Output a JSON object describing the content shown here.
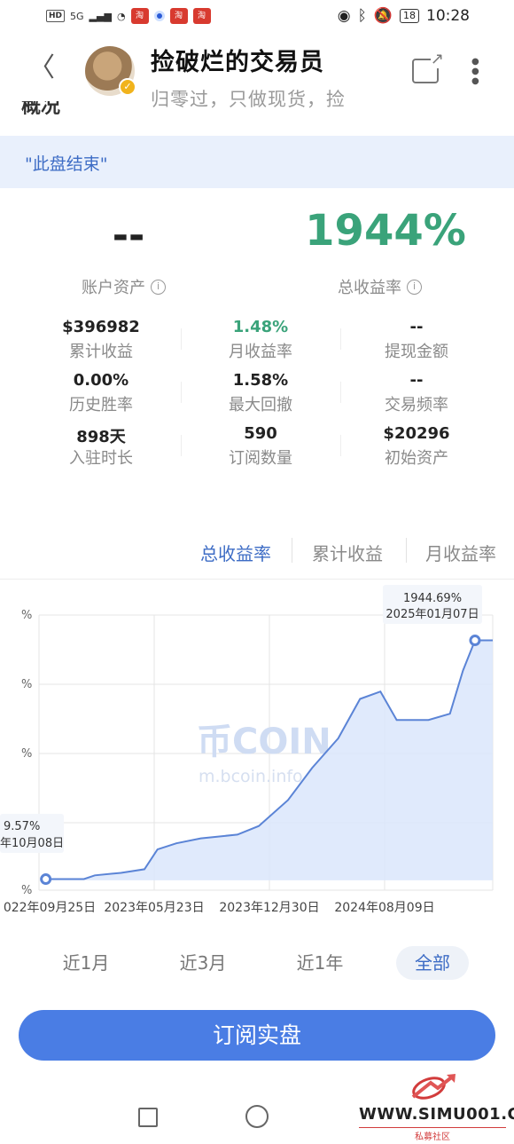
{
  "status_bar": {
    "left_badges": [
      "HD",
      "5G"
    ],
    "time": "10:28",
    "battery": "18"
  },
  "header": {
    "title": "捡破烂的交易员",
    "subtitle": "归零过，只做现货，捡",
    "section_title": "概况"
  },
  "banner": {
    "text": "\"此盘结束\""
  },
  "summary": {
    "asset_value": "--",
    "asset_label": "账户资产",
    "return_value": "1944%",
    "return_label": "总收益率"
  },
  "stats": [
    {
      "value": "$396982",
      "label": "累计收益"
    },
    {
      "value": "1.48%",
      "label": "月收益率",
      "accent": "green"
    },
    {
      "value": "--",
      "label": "提现金额"
    },
    {
      "value": "0.00%",
      "label": "历史胜率"
    },
    {
      "value": "1.58%",
      "label": "最大回撤"
    },
    {
      "value": "--",
      "label": "交易频率"
    },
    {
      "value": "898天",
      "label": "入驻时长"
    },
    {
      "value": "590",
      "label": "订阅数量"
    },
    {
      "value": "$20296",
      "label": "初始资产"
    }
  ],
  "tabs": [
    {
      "label": "总收益率",
      "active": true
    },
    {
      "label": "累计收益",
      "active": false
    },
    {
      "label": "月收益率",
      "active": false
    }
  ],
  "chart_data": {
    "type": "area",
    "x_ticks": [
      "022年09月25日",
      "2023年05月23日",
      "2023年12月30日",
      "2024年08月09日"
    ],
    "y_ticks": [
      "%",
      "%",
      "%",
      "%",
      "%"
    ],
    "start_tooltip": {
      "value": "9.57%",
      "date": "年10月08日"
    },
    "end_tooltip": {
      "value": "1944.69%",
      "date": "2025年01月07日"
    },
    "series": [
      {
        "x": "2022-10-08",
        "y": 9.57
      },
      {
        "x": "2022-12-20",
        "y": 9.6
      },
      {
        "x": "2023-01-10",
        "y": 40
      },
      {
        "x": "2023-03-01",
        "y": 60
      },
      {
        "x": "2023-04-15",
        "y": 90
      },
      {
        "x": "2023-05-10",
        "y": 250
      },
      {
        "x": "2023-06-15",
        "y": 300
      },
      {
        "x": "2023-08-01",
        "y": 340
      },
      {
        "x": "2023-10-10",
        "y": 370
      },
      {
        "x": "2023-11-20",
        "y": 440
      },
      {
        "x": "2024-01-15",
        "y": 650
      },
      {
        "x": "2024-03-01",
        "y": 910
      },
      {
        "x": "2024-04-20",
        "y": 1150
      },
      {
        "x": "2024-06-01",
        "y": 1470
      },
      {
        "x": "2024-07-10",
        "y": 1530
      },
      {
        "x": "2024-08-10",
        "y": 1300
      },
      {
        "x": "2024-10-10",
        "y": 1300
      },
      {
        "x": "2024-11-20",
        "y": 1350
      },
      {
        "x": "2024-12-15",
        "y": 1700
      },
      {
        "x": "2025-01-07",
        "y": 1944.69
      },
      {
        "x": "2025-02-10",
        "y": 1944.69
      }
    ],
    "grid": true,
    "colors": {
      "line": "#5b84d6",
      "fill": "#dbe6fb"
    }
  },
  "watermark": {
    "brand": "币COIN",
    "url": "m.bcoin.info"
  },
  "ranges": [
    {
      "label": "近1月",
      "active": false
    },
    {
      "label": "近3月",
      "active": false
    },
    {
      "label": "近1年",
      "active": false
    },
    {
      "label": "全部",
      "active": true
    }
  ],
  "subscribe_label": "订阅实盘",
  "site_watermark": {
    "domain": "WWW.SIMU001.CN",
    "caption": "私募社区"
  },
  "colors": {
    "accent": "#4a7de4",
    "green": "#3aa37a",
    "banner_bg": "#e9f0fc"
  }
}
